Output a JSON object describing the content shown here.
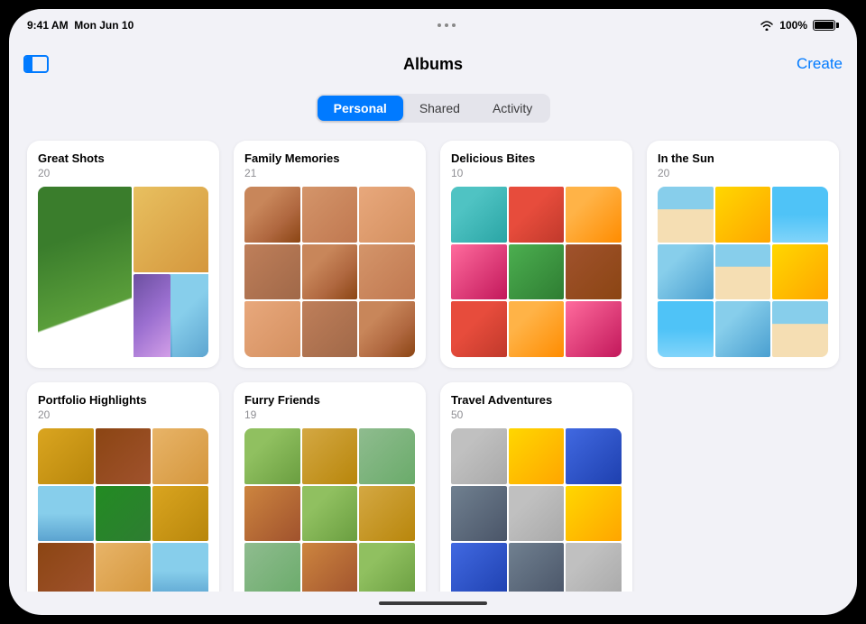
{
  "statusBar": {
    "time": "9:41 AM",
    "date": "Mon Jun 10",
    "battery": "100%",
    "dots": [
      "•",
      "•",
      "•"
    ]
  },
  "header": {
    "title": "Albums",
    "createLabel": "Create",
    "sidebarAriaLabel": "Sidebar toggle"
  },
  "tabs": [
    {
      "id": "personal",
      "label": "Personal",
      "active": true
    },
    {
      "id": "shared",
      "label": "Shared",
      "active": false
    },
    {
      "id": "activity",
      "label": "Activity",
      "active": false
    }
  ],
  "albums": [
    {
      "id": "great-shots",
      "title": "Great Shots",
      "count": "20",
      "photos": [
        "gs1",
        "gs2",
        "gs3",
        "gs4",
        "gs5",
        "p7"
      ]
    },
    {
      "id": "family-memories",
      "title": "Family Memories",
      "count": "21",
      "photos": [
        "fm1",
        "fm2",
        "fm3",
        "fm4",
        "p6",
        "p7",
        "p8",
        "p9",
        "p10"
      ]
    },
    {
      "id": "delicious-bites",
      "title": "Delicious Bites",
      "count": "10",
      "photos": [
        "fd1",
        "fd2",
        "fd3",
        "fd4",
        "fd5",
        "fd6",
        "p7",
        "p8",
        "p9"
      ]
    },
    {
      "id": "in-the-sun",
      "title": "In the Sun",
      "count": "20",
      "photos": [
        "sn1",
        "sn2",
        "sn3",
        "sn4",
        "p7",
        "p8",
        "p9",
        "p10",
        "p11"
      ]
    },
    {
      "id": "portfolio-highlights",
      "title": "Portfolio Highlights",
      "count": "20",
      "photos": [
        "ph1",
        "ph2",
        "ph3",
        "ph4",
        "ph5",
        "p7",
        "p8",
        "p9"
      ]
    },
    {
      "id": "furry-friends",
      "title": "Furry Friends",
      "count": "19",
      "photos": [
        "ff1",
        "ff2",
        "ff3",
        "ff4",
        "p7",
        "p8",
        "p9",
        "p10",
        "p11"
      ]
    },
    {
      "id": "travel-adventures",
      "title": "Travel Adventures",
      "count": "50",
      "photos": [
        "tv1",
        "tv2",
        "tv3",
        "tv4",
        "p7",
        "p8",
        "p9",
        "p10",
        "p11"
      ]
    }
  ]
}
